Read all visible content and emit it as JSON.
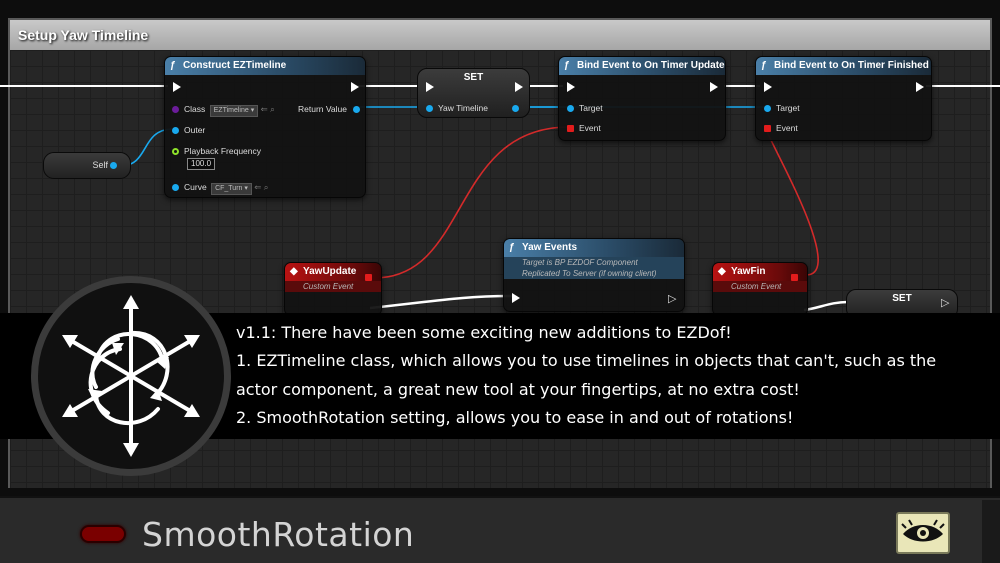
{
  "graph": {
    "comment_title": "Setup Yaw Timeline",
    "construct_node": {
      "title": "Construct EZTimeline",
      "class_label": "Class",
      "class_value": "EZTimeline",
      "outer_label": "Outer",
      "playback_label": "Playback Frequency",
      "playback_value": "100.0",
      "curve_label": "Curve",
      "curve_value": "CF_Turn",
      "return_label": "Return Value"
    },
    "set_node_1": {
      "title": "SET",
      "pin_label": "Yaw Timeline"
    },
    "bind_update": {
      "title": "Bind Event to On Timer Update",
      "target_label": "Target",
      "event_label": "Event"
    },
    "bind_finished": {
      "title": "Bind Event to On Timer Finished",
      "target_label": "Target",
      "event_label": "Event"
    },
    "self_node": {
      "label": "Self"
    },
    "yaw_update": {
      "title": "YawUpdate",
      "subtitle": "Custom Event"
    },
    "yaw_events": {
      "title": "Yaw Events",
      "line1": "Target is BP EZDOF Component",
      "line2": "Replicated To Server (if owning client)"
    },
    "yaw_fin": {
      "title": "YawFin",
      "subtitle": "Custom Event"
    },
    "set_node_2": {
      "title": "SET"
    }
  },
  "banner": {
    "lines": [
      "v1.1: There have been some exciting new additions to EZDof!",
      "1. EZTimeline class, which allows you to use timelines in objects that can't, such as the",
      "actor component, a great new tool at your fingertips, at no extra cost!",
      "2. SmoothRotation setting, allows you to ease in and out of rotations!"
    ]
  },
  "details": {
    "property_label": "SmoothRotation",
    "toggle_color": "#7a0000"
  },
  "icons": [
    "logo-icon",
    "eye-icon",
    "function-icon",
    "event-icon"
  ],
  "colors": {
    "object_pin": "#19a9ee",
    "delegate_pin": "#e21c1c",
    "class_pin": "#6b1c9a",
    "float_pin": "#8ee22a"
  }
}
